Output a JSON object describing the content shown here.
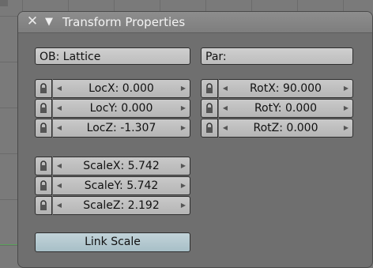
{
  "panel": {
    "title": "Transform Properties",
    "close_icon": "close-icon",
    "collapse_icon": "collapse-triangle-icon"
  },
  "object_field": {
    "value": "OB: Lattice"
  },
  "parent_field": {
    "value": "Par:"
  },
  "location": [
    {
      "label": "LocX: 0.000"
    },
    {
      "label": "LocY: 0.000"
    },
    {
      "label": "LocZ: -1.307"
    }
  ],
  "rotation": [
    {
      "label": "RotX: 90.000"
    },
    {
      "label": "RotY: 0.000"
    },
    {
      "label": "RotZ: 0.000"
    }
  ],
  "scale": [
    {
      "label": "ScaleX: 5.742"
    },
    {
      "label": "ScaleY: 5.742"
    },
    {
      "label": "ScaleZ: 2.192"
    }
  ],
  "link_scale": {
    "label": "Link Scale"
  },
  "colors": {
    "panel_bg": "#6f6f6f",
    "field_bg": "#c9c9c9",
    "link_scale_bg": "#b4c9d0",
    "axis_line": "#5aa25a"
  }
}
